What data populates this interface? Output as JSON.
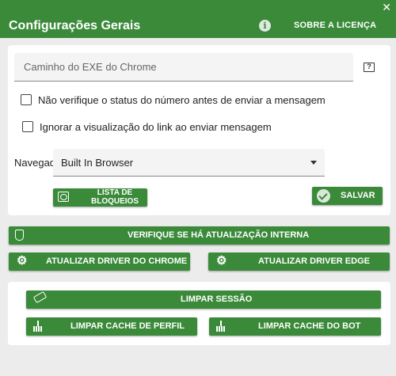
{
  "window": {
    "close_glyph": "✕"
  },
  "header": {
    "title": "Configurações Gerais",
    "about_label": "SOBRE A LICENÇA",
    "about_icon": "info-icon"
  },
  "settings": {
    "chrome_path": {
      "value": "",
      "placeholder": "Caminho do EXE do Chrome"
    },
    "help_glyph": "?",
    "checkboxes": [
      {
        "label": "Não verifique o status do número antes de enviar a mensagem",
        "checked": false
      },
      {
        "label": "Ignorar a visualização do link ao enviar mensagem",
        "checked": false
      }
    ],
    "browser_label": "Navegad",
    "browser_value": "Built In Browser"
  },
  "buttons": {
    "block_list": "LISTA DE BLOQUEIOS",
    "save": "SALVAR",
    "check_update": "VERIFIQUE SE HÁ ATUALIZAÇÃO INTERNA",
    "update_chrome_driver": "ATUALIZAR DRIVER DO CHROME",
    "update_edge_driver": "ATUALIZAR DRIVER EDGE",
    "clear_session": "LIMPAR SESSÃO",
    "clear_profile_cache": "LIMPAR CACHE DE PERFIL",
    "clear_bot_cache": "LIMPAR CACHE DO BOT"
  },
  "colors": {
    "accent": "#3a8a3a",
    "background": "#ececec",
    "panel": "#ffffff"
  }
}
